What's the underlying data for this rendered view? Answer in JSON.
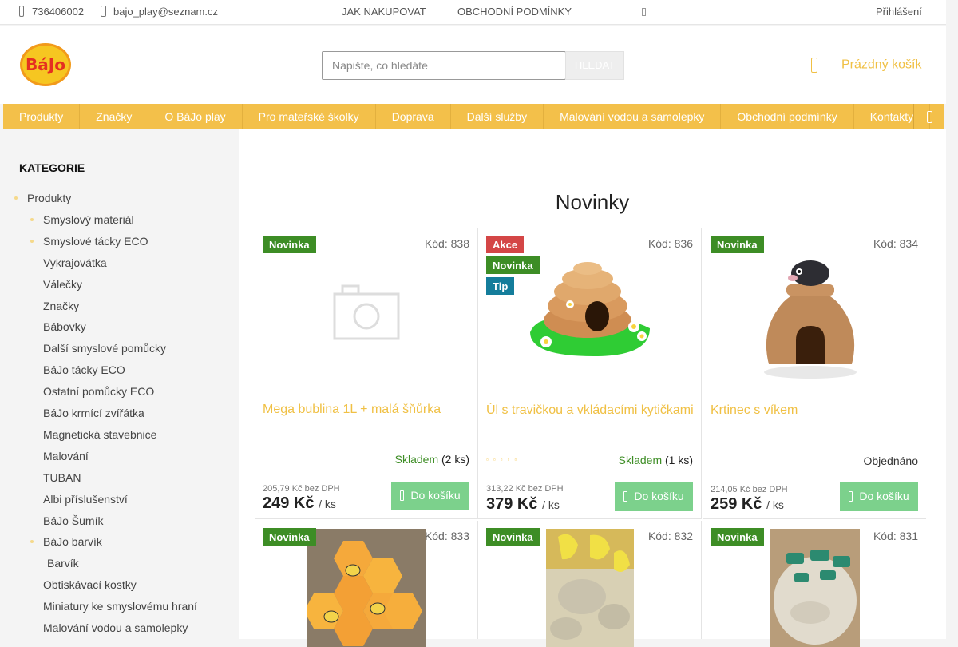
{
  "topbar": {
    "phone": "736406002",
    "email": "bajo_play@seznam.cz",
    "link_how_to_buy": "JAK NAKUPOVAT",
    "link_terms": "OBCHODNÍ PODMÍNKY",
    "login": "Přihlášení"
  },
  "header": {
    "logo_text": "BáJo",
    "search_placeholder": "Napište, co hledáte",
    "search_button": "HLEDAT",
    "cart_label": "Prázdný košík"
  },
  "menu": [
    "Produkty",
    "Značky",
    "O BáJo play",
    "Pro mateřské školky",
    "Doprava",
    "Další služby",
    "Malování vodou a samolepky",
    "Obchodní podmínky",
    "Kontakty"
  ],
  "sidebar": {
    "title": "KATEGORIE",
    "items": [
      {
        "label": "Produkty",
        "level": 0,
        "bullet": true
      },
      {
        "label": "Smyslový materiál",
        "level": 1,
        "bullet": true
      },
      {
        "label": "Smyslové tácky ECO",
        "level": 1,
        "bullet": true
      },
      {
        "label": "Vykrajovátka",
        "level": 1,
        "bullet": false
      },
      {
        "label": "Válečky",
        "level": 1,
        "bullet": false
      },
      {
        "label": "Značky",
        "level": 1,
        "bullet": false
      },
      {
        "label": "Bábovky",
        "level": 1,
        "bullet": false
      },
      {
        "label": "Další smyslové pomůcky",
        "level": 1,
        "bullet": false
      },
      {
        "label": "BáJo tácky ECO",
        "level": 1,
        "bullet": false
      },
      {
        "label": "Ostatní pomůcky ECO",
        "level": 1,
        "bullet": false
      },
      {
        "label": "BáJo krmící zvířátka",
        "level": 1,
        "bullet": false
      },
      {
        "label": "Magnetická stavebnice",
        "level": 1,
        "bullet": false
      },
      {
        "label": "Malování",
        "level": 1,
        "bullet": false
      },
      {
        "label": "TUBAN",
        "level": 1,
        "bullet": false
      },
      {
        "label": "Albi příslušenství",
        "level": 1,
        "bullet": false
      },
      {
        "label": "BáJo Šumík",
        "level": 1,
        "bullet": false
      },
      {
        "label": "BáJo barvík",
        "level": 1,
        "bullet": true
      },
      {
        "label": "Barvík",
        "level": 2,
        "bullet": false
      },
      {
        "label": "Obtiskávací kostky",
        "level": 1,
        "bullet": false
      },
      {
        "label": "Miniatury ke smyslovému hraní",
        "level": 1,
        "bullet": false
      },
      {
        "label": "Malování vodou a samolepky",
        "level": 1,
        "bullet": false
      }
    ]
  },
  "main": {
    "title": "Novinky",
    "products": [
      {
        "badges": [
          "Novinka"
        ],
        "code": "Kód: 838",
        "name": "Mega bublina 1L + malá šňůrka",
        "stock_status": "Skladem",
        "stock_count": "(2 ks)",
        "price_net": "205,79 Kč bez DPH",
        "price": "249 Kč",
        "unit": "/ ks",
        "buy": "Do košíku"
      },
      {
        "badges": [
          "Akce",
          "Novinka",
          "Tip"
        ],
        "code": "Kód: 836",
        "name": "Úl s travičkou a vkládacími kytičkami",
        "stock_status": "Skladem",
        "stock_count": "(1 ks)",
        "price_net": "313,22 Kč bez DPH",
        "price": "379 Kč",
        "unit": "/ ks",
        "buy": "Do košíku"
      },
      {
        "badges": [
          "Novinka"
        ],
        "code": "Kód: 834",
        "name": "Krtinec s víkem",
        "stock_status": "Objednáno",
        "stock_count": "",
        "price_net": "214,05 Kč bez DPH",
        "price": "259 Kč",
        "unit": "/ ks",
        "buy": "Do košíku"
      },
      {
        "badges": [
          "Novinka"
        ],
        "code": "Kód: 833"
      },
      {
        "badges": [
          "Novinka"
        ],
        "code": "Kód: 832"
      },
      {
        "badges": [
          "Novinka"
        ],
        "code": "Kód: 831"
      }
    ]
  },
  "colors": {
    "accent": "#f3c04a",
    "novinka": "#3d8d25",
    "akce": "#d44646",
    "tip": "#147d9b",
    "buy_button": "#7cd18c"
  }
}
